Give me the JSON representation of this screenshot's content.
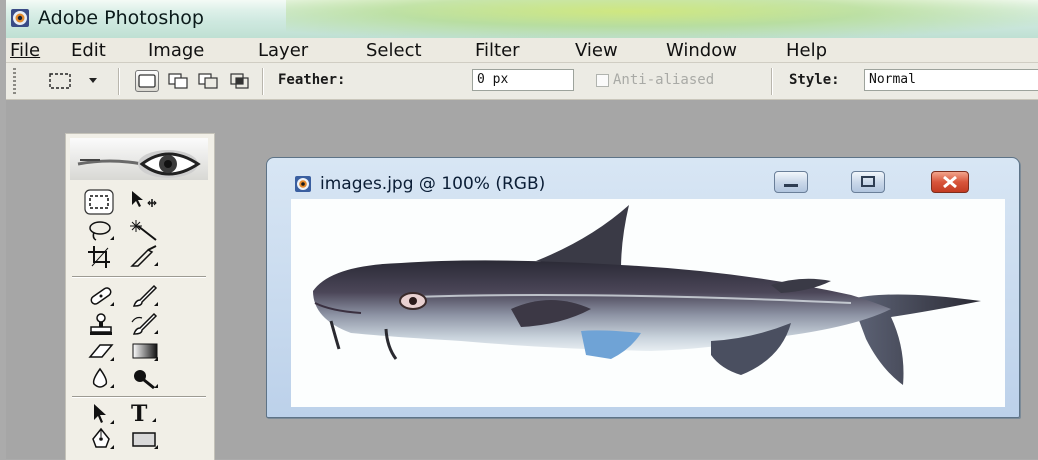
{
  "window": {
    "title": "Adobe Photoshop",
    "app_icon": "photoshop-eye-icon"
  },
  "menu": [
    {
      "label": "File"
    },
    {
      "label": "Edit"
    },
    {
      "label": "Image"
    },
    {
      "label": "Layer"
    },
    {
      "label": "Select"
    },
    {
      "label": "Filter"
    },
    {
      "label": "View"
    },
    {
      "label": "Window"
    },
    {
      "label": "Help"
    }
  ],
  "options_bar": {
    "tool_icon": "rectangular-marquee-icon",
    "selection_modes": [
      "new-selection-icon",
      "add-to-selection-icon",
      "subtract-from-selection-icon",
      "intersect-selection-icon"
    ],
    "feather_label": "Feather:",
    "feather_value": "0 px",
    "antialiased_label": "Anti-aliased",
    "antialiased_checked": false,
    "style_label": "Style:",
    "style_value": "Normal"
  },
  "toolbox": {
    "header_icon": "photoshop-eye-logo",
    "tools": [
      "rectangular-marquee-icon",
      "move-icon",
      "lasso-icon",
      "magic-wand-icon",
      "crop-icon",
      "slice-icon",
      "healing-brush-icon",
      "brush-icon",
      "clone-stamp-icon",
      "history-brush-icon",
      "eraser-icon",
      "gradient-icon",
      "blur-icon",
      "dodge-icon",
      "path-selection-icon",
      "type-icon",
      "pen-icon",
      "rectangle-shape-icon"
    ],
    "type_tool_glyph": "T"
  },
  "document": {
    "title": "images.jpg @ 100% (RGB)",
    "image_content": "fish",
    "controls": [
      "minimize",
      "maximize",
      "close"
    ]
  },
  "colors": {
    "workspace": "#a6a6a6",
    "menu_bg": "#eceae1",
    "close_red": "#d8553b",
    "doc_frame": "#bcd1ea"
  }
}
